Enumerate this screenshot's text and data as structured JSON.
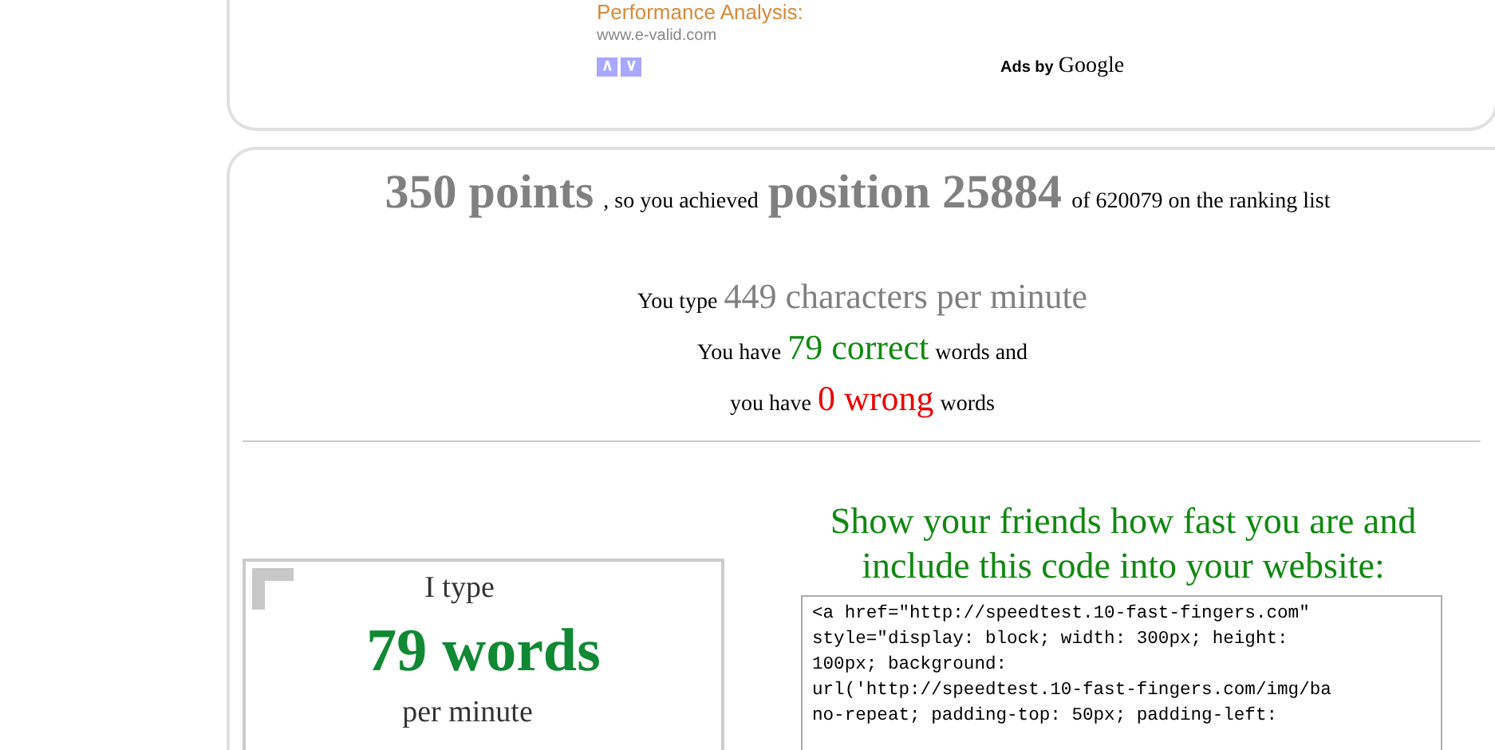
{
  "ad": {
    "headline": "Performance Analysis:",
    "url": "www.e-valid.com",
    "nav": [
      "∧",
      "∨"
    ],
    "ads_by": "Ads by",
    "brand": "Google"
  },
  "result": {
    "points": "350 points",
    "mid": ", so you achieved",
    "position": "position 25884",
    "tail": "of 620079 on the ranking list"
  },
  "stats": [
    {
      "kind": "cpm",
      "prefix": "You type",
      "value": "449 characters per minute"
    },
    {
      "kind": "correct",
      "prefix": "You have",
      "value": "79 correct",
      "suffix": "words and"
    },
    {
      "kind": "wrong",
      "prefix": "you have",
      "value": "0 wrong",
      "suffix": "words"
    }
  ],
  "badge": {
    "line1": "I type",
    "words": "79 words",
    "line3": "per minute"
  },
  "share": {
    "heading": "Show your friends how fast you are and include this code into your website:",
    "code_lines": [
      "<a href=\"http://speedtest.10-fast-fingers.com\"",
      "style=\"display: block; width: 300px; height:",
      "100px; background:",
      "url('http://speedtest.10-fast-fingers.com/img/ba",
      "no-repeat; padding-top: 50px; padding-left:"
    ]
  }
}
